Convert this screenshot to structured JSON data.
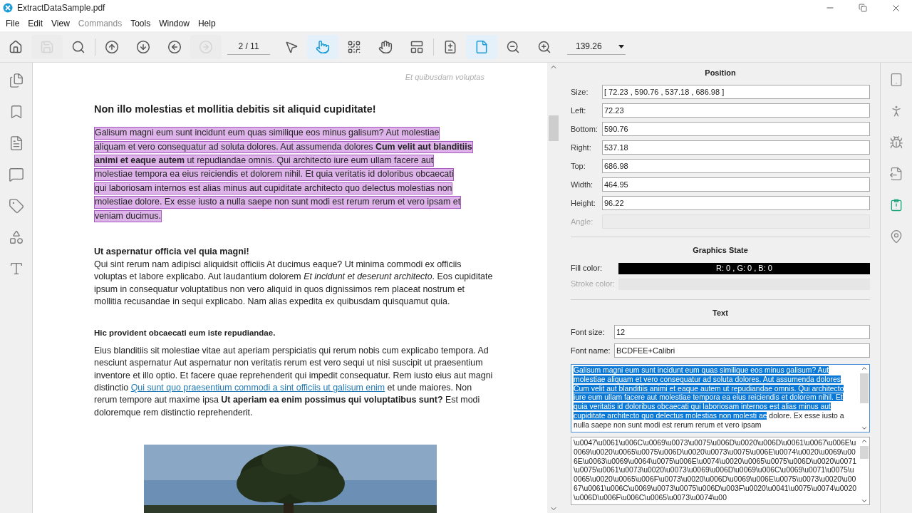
{
  "window": {
    "title": "ExtractDataSample.pdf"
  },
  "menu": [
    {
      "label": "File",
      "disabled": false
    },
    {
      "label": "Edit",
      "disabled": false
    },
    {
      "label": "View",
      "disabled": false
    },
    {
      "label": "Commands",
      "disabled": true
    },
    {
      "label": "Tools",
      "disabled": false
    },
    {
      "label": "Window",
      "disabled": false
    },
    {
      "label": "Help",
      "disabled": false
    }
  ],
  "toolbar": {
    "buttons": [
      {
        "disabled": false
      },
      {
        "disabled": true
      },
      {
        "disabled": false
      },
      {
        "disabled": false
      },
      {
        "disabled": false
      },
      {
        "disabled": false
      },
      {
        "disabled": true
      }
    ],
    "page": "2 / 11",
    "tools": [
      {
        "selected": false
      },
      {
        "selected": true
      },
      {
        "selected": false
      },
      {
        "selected": false
      },
      {
        "selected": false
      },
      {
        "selected": false
      },
      {
        "selected": true
      },
      {
        "selected": false
      },
      {
        "selected": false
      }
    ],
    "zoom": "139.26"
  },
  "document": {
    "running_header": "Et quibusdam voluptas",
    "heading": "Non illo molestias et mollitia debitis sit aliquid cupiditate!",
    "highlighted_lines": [
      "Galisum magni eum sunt incidunt eum quas similique eos minus galisum? Aut molestiae",
      "aliquam et vero consequatur ad soluta dolores. Aut assumenda dolores **Cum velit aut blanditiis**",
      "**animi et eaque autem** ut repudiandae omnis. Qui architecto iure eum ullam facere aut",
      "molestiae tempora ea eius reiciendis et dolorem nihil. Et quia veritatis id doloribus obcaecati",
      "qui laboriosam internos est alias minus aut cupiditate architecto quo delectus molestias non",
      "molestiae dolore. Ex esse iusto a nulla saepe non sunt modi est rerum rerum et vero ipsam et",
      "veniam ducimus."
    ],
    "subheading_1": "Ut aspernatur officia vel quia magni!",
    "paragraph_1": "Qui sint rerum nam adipisci aliquidsit officiis At ducimus eaque? Ut minima commodi ex officiis voluptas et labore explicabo. Aut laudantium dolorem *Et incidunt et deserunt architecto*. Eos cupiditate ipsum in consequatur voluptatibus non vero aliquid in quos dignissimos rem placeat nostrum et mollitia recusandae in sequi explicabo. Nam alias expedita ex quibusdam quisquamut quia.",
    "subheading_2": "Hic provident obcaecati eum iste repudiandae.",
    "paragraph_2": [
      {
        "kind": "text",
        "text": "Eius blanditiis sit molestiae vitae aut aperiam perspiciatis qui rerum nobis cum explicabo tempora. Ad nesciunt aspernatur Aut aspernatur non veritatis rerum est vero sequi ut nisi suscipit ut praesentium inventore et illo optio. Et facere quae reprehenderit qui impedit consequatur. Rem iusto eius aut magni distinctio"
      },
      {
        "kind": "link",
        "text": "Qui sunt quo praesentium commodi a sint officiis ut galisum enim"
      },
      {
        "kind": "text",
        "text": "et unde maiores. Non rerum tempore aut maxime ipsa **Ut aperiam ea enim possimus qui voluptatibus sunt?** Est modi doloremque rem distinctio reprehenderit."
      }
    ],
    "figure": {
      "kind": "picture"
    }
  },
  "properties": {
    "position": {
      "title": "Position",
      "fields": [
        {
          "label": "Size:",
          "value": "[ 72.23 , 590.76 , 537.18 , 686.98 ]",
          "disabled": false
        },
        {
          "label": "Left:",
          "value": "72.23",
          "disabled": false
        },
        {
          "label": "Bottom:",
          "value": "590.76",
          "disabled": false
        },
        {
          "label": "Right:",
          "value": "537.18",
          "disabled": false
        },
        {
          "label": "Top:",
          "value": "686.98",
          "disabled": false
        },
        {
          "label": "Width:",
          "value": "464.95",
          "disabled": false
        },
        {
          "label": "Height:",
          "value": "96.22",
          "disabled": false
        },
        {
          "label": "Angle:",
          "disabled": true
        }
      ]
    },
    "graphics_state": {
      "title": "Graphics State",
      "fill": {
        "label": "Fill color:",
        "value": "R: 0 , G: 0 , B: 0"
      },
      "stroke": {
        "label": "Stroke color:",
        "disabled": true
      }
    },
    "text": {
      "title": "Text",
      "fields": [
        {
          "label": "Font size:",
          "value": "12"
        },
        {
          "label": "Font name:",
          "value": "BCDFEE+Calibri"
        }
      ],
      "content_selected": "Galisum magni eum sunt incidunt eum quas similique eos minus galisum? Aut molestiae  aliquam et vero consequatur ad soluta dolores. Aut assumenda dolores Cum velit aut blanditiis  animi et eaque autem   ut  repudiandae omnis. Qui architecto iure eum ullam facere aut  molestiae tempora ea eius reiciendis et dolorem nihil. Et quia veritatis id doloribus obcaecati  qui laboriosam internos est alias minus aut cupiditate architecto quo delectus molestias non  molesti ae",
      "content_rest": "dolore. Ex esse iusto a nulla saepe non sunt modi est rerum rerum et vero ipsam",
      "unicode": "\\u0047\\u0061\\u006C\\u0069\\u0073\\u0075\\u006D\\u0020\\u006D\\u0061\\u0067\\u006E\\u0069\\u0020\\u0065\\u0075\\u006D\\u0020\\u0073\\u0075\\u006E\\u0074\\u0020\\u0069\\u006E\\u0063\\u0069\\u0064\\u0075\\u006E\\u0074\\u0020\\u0065\\u0075\\u006D\\u0020\\u0071\\u0075\\u0061\\u0073\\u0020\\u0073\\u0069\\u006D\\u0069\\u006C\\u0069\\u0071\\u0075\\u0065\\u0020\\u0065\\u006F\\u0073\\u0020\\u006D\\u0069\\u006E\\u0075\\u0073\\u0020\\u0067\\u0061\\u006C\\u0069\\u0073\\u0075\\u006D\\u003F\\u0020\\u0041\\u0075\\u0074\\u0020\\u006D\\u006F\\u006C\\u0065\\u0073\\u0074\\u00"
    }
  },
  "right_rail": [
    {
      "selected": false
    },
    {
      "selected": false
    },
    {
      "selected": false
    },
    {
      "selected": false
    },
    {
      "selected": true
    },
    {
      "selected": false
    }
  ]
}
